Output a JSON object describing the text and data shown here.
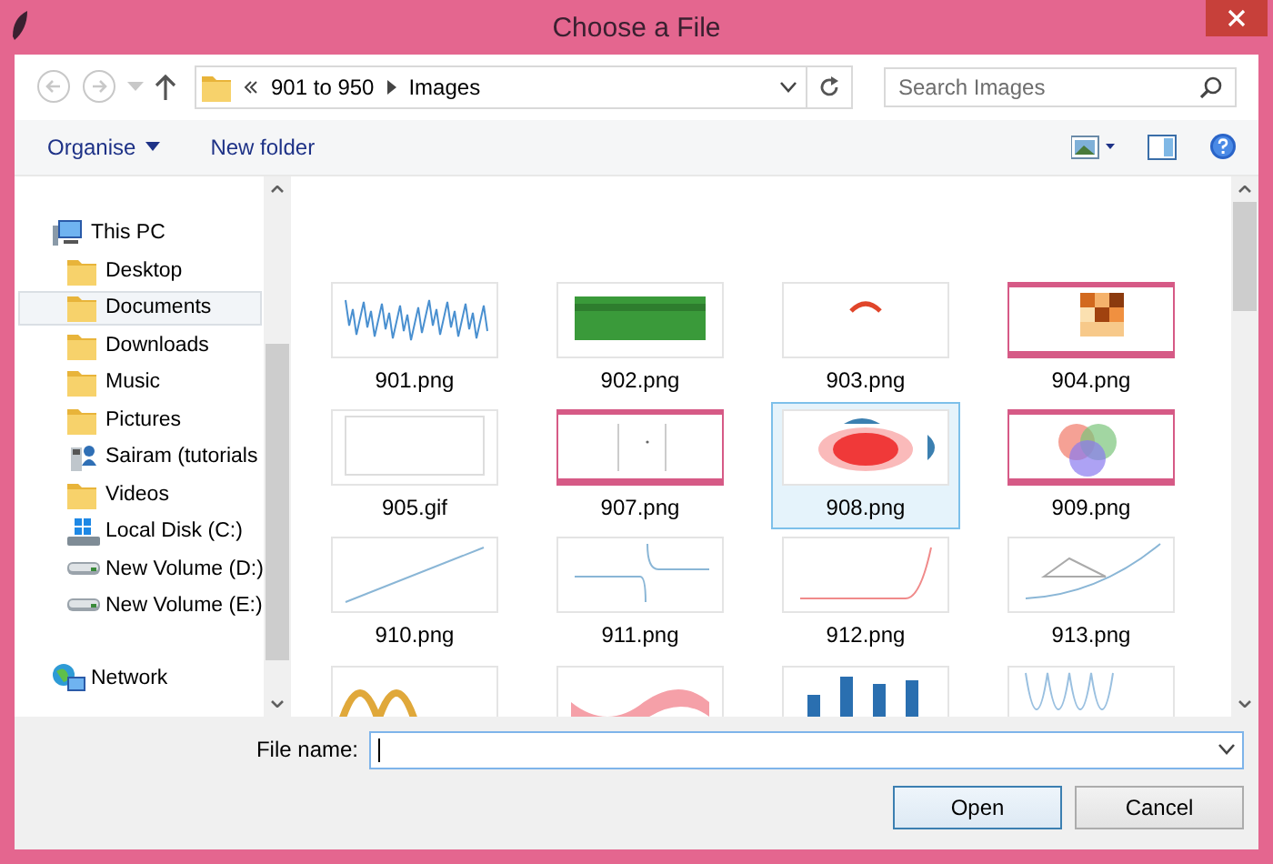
{
  "window": {
    "title": "Choose a File"
  },
  "address": {
    "path": [
      "901 to 950",
      "Images"
    ]
  },
  "search": {
    "placeholder": "Search Images"
  },
  "toolbar": {
    "organise": "Organise",
    "new_folder": "New folder"
  },
  "navigation": [
    {
      "label": "This PC",
      "kind": "computer",
      "selected": false,
      "children": [
        {
          "label": "Desktop",
          "kind": "folder",
          "selected": false
        },
        {
          "label": "Documents",
          "kind": "folder",
          "selected": true
        },
        {
          "label": "Downloads",
          "kind": "folder",
          "selected": false
        },
        {
          "label": "Music",
          "kind": "folder",
          "selected": false
        },
        {
          "label": "Pictures",
          "kind": "folder",
          "selected": false
        },
        {
          "label": "Sairam (tutorials",
          "kind": "user",
          "selected": false
        },
        {
          "label": "Videos",
          "kind": "folder",
          "selected": false
        },
        {
          "label": "Local Disk (C:)",
          "kind": "system-drive",
          "selected": false
        },
        {
          "label": "New Volume (D:)",
          "kind": "drive",
          "selected": false
        },
        {
          "label": "New Volume (E:)",
          "kind": "drive",
          "selected": false
        }
      ]
    },
    {
      "label": "Network",
      "kind": "network",
      "selected": false
    }
  ],
  "files": [
    {
      "name": "901.png",
      "selected": false
    },
    {
      "name": "902.png",
      "selected": false
    },
    {
      "name": "903.png",
      "selected": false
    },
    {
      "name": "904.png",
      "selected": false
    },
    {
      "name": "905.gif",
      "selected": false
    },
    {
      "name": "907.png",
      "selected": false
    },
    {
      "name": "908.png",
      "selected": true
    },
    {
      "name": "909.png",
      "selected": false
    },
    {
      "name": "910.png",
      "selected": false
    },
    {
      "name": "911.png",
      "selected": false
    },
    {
      "name": "912.png",
      "selected": false
    },
    {
      "name": "913.png",
      "selected": false
    },
    {
      "kind": "picture"
    },
    {
      "kind": "picture"
    },
    {
      "kind": "picture"
    },
    {
      "kind": "picture"
    }
  ],
  "file_name": {
    "label": "File name:"
  },
  "buttons": [
    {
      "label": "Open",
      "default": true
    },
    {
      "label": "Cancel",
      "default": false
    }
  ]
}
